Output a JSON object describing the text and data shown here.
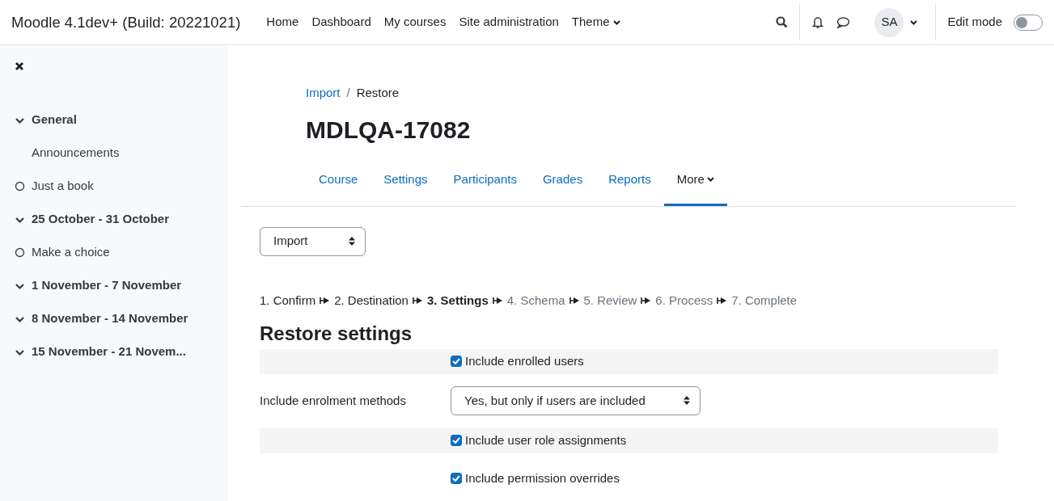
{
  "navbar": {
    "brand": "Moodle 4.1dev+ (Build: 20221021)",
    "links": [
      {
        "label": "Home",
        "dropdown": false
      },
      {
        "label": "Dashboard",
        "dropdown": false
      },
      {
        "label": "My courses",
        "dropdown": false
      },
      {
        "label": "Site administration",
        "dropdown": false
      },
      {
        "label": "Theme",
        "dropdown": true
      }
    ],
    "avatar": "SA",
    "edit_mode": {
      "label": "Edit mode",
      "on": false
    }
  },
  "sidebar": {
    "items": [
      {
        "label": "General",
        "kind": "section",
        "expanded": true,
        "children": [
          {
            "label": "Announcements",
            "kind": "activity",
            "completion": false
          },
          {
            "label": "Just a book",
            "kind": "activity",
            "completion": true
          }
        ]
      },
      {
        "label": "25 October - 31 October",
        "kind": "section",
        "expanded": true,
        "children": [
          {
            "label": "Make a choice",
            "kind": "activity",
            "completion": true
          }
        ]
      },
      {
        "label": "1 November - 7 November",
        "kind": "section",
        "expanded": true
      },
      {
        "label": "8 November - 14 November",
        "kind": "section",
        "expanded": true
      },
      {
        "label": "15 November - 21 Novem...",
        "kind": "section",
        "expanded": true
      }
    ]
  },
  "breadcrumb": {
    "separator": "/",
    "items": [
      {
        "label": "Import",
        "link": true
      },
      {
        "label": "Restore",
        "link": false
      }
    ]
  },
  "page_title": "MDLQA-17082",
  "tabs": [
    {
      "label": "Course",
      "selected": false,
      "dropdown": false
    },
    {
      "label": "Settings",
      "selected": false,
      "dropdown": false
    },
    {
      "label": "Participants",
      "selected": false,
      "dropdown": false
    },
    {
      "label": "Grades",
      "selected": false,
      "dropdown": false
    },
    {
      "label": "Reports",
      "selected": false,
      "dropdown": false
    },
    {
      "label": "More",
      "selected": true,
      "dropdown": true
    }
  ],
  "action_select": "Import",
  "steps": [
    {
      "label": "1. Confirm",
      "selected": false,
      "disabled": false
    },
    {
      "label": "2. Destination",
      "selected": false,
      "disabled": false
    },
    {
      "label": "3. Settings",
      "selected": true,
      "disabled": false
    },
    {
      "label": "4. Schema",
      "selected": false,
      "disabled": true
    },
    {
      "label": "5. Review",
      "selected": false,
      "disabled": true
    },
    {
      "label": "6. Process",
      "selected": false,
      "disabled": true
    },
    {
      "label": "7. Complete",
      "selected": false,
      "disabled": true
    }
  ],
  "section_title": "Restore settings",
  "settings": [
    {
      "kind": "checkbox",
      "label": "Include enrolled users",
      "checked": true
    },
    {
      "kind": "select",
      "label": "Include enrolment methods",
      "value": "Yes, but only if users are included"
    },
    {
      "kind": "checkbox",
      "label": "Include user role assignments",
      "checked": true
    },
    {
      "kind": "checkbox",
      "label": "Include permission overrides",
      "checked": true
    }
  ]
}
